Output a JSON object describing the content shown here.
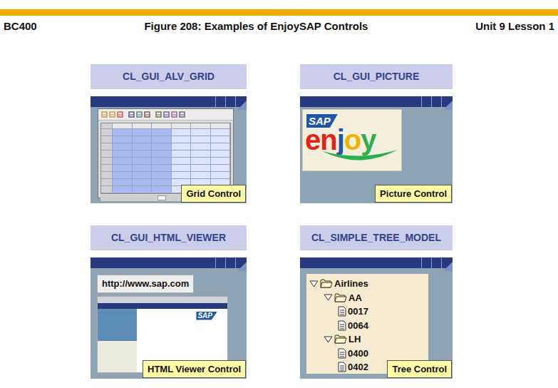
{
  "header": {
    "course": "BC400",
    "title": "Figure 208: Examples of EnjoySAP Controls",
    "unit": "Unit 9 Lesson 1"
  },
  "panels": [
    {
      "kind": "grid",
      "class_name": "CL_GUI_ALV_GRID",
      "caption": "Grid Control",
      "columns": [
        {
          "selected": true
        },
        {
          "selected": true
        },
        {
          "selected": true
        },
        {
          "selected": false
        },
        {
          "selected": false
        },
        {
          "selected": false
        }
      ]
    },
    {
      "kind": "picture",
      "class_name": "CL_GUI_PICTURE",
      "caption": "Picture Control",
      "logo": {
        "badge": "SAP",
        "word": "enjoy"
      }
    },
    {
      "kind": "html",
      "class_name": "CL_GUI_HTML_VIEWER",
      "caption": "HTML Viewer Control",
      "url": "http://www.sap.com",
      "logo": "SAP"
    },
    {
      "kind": "tree",
      "class_name": "CL_SIMPLE_TREE_MODEL",
      "caption": "Tree Control",
      "nodes": [
        {
          "text": "Airlines",
          "kind": "folder",
          "expanded": true,
          "children": [
            {
              "text": "AA",
              "kind": "folder",
              "expanded": true,
              "children": [
                {
                  "text": "0017",
                  "kind": "item"
                },
                {
                  "text": "0064",
                  "kind": "item"
                }
              ]
            },
            {
              "text": "LH",
              "kind": "folder",
              "expanded": true,
              "children": [
                {
                  "text": "0400",
                  "kind": "item"
                },
                {
                  "text": "0402",
                  "kind": "item"
                }
              ]
            }
          ]
        }
      ]
    }
  ]
}
